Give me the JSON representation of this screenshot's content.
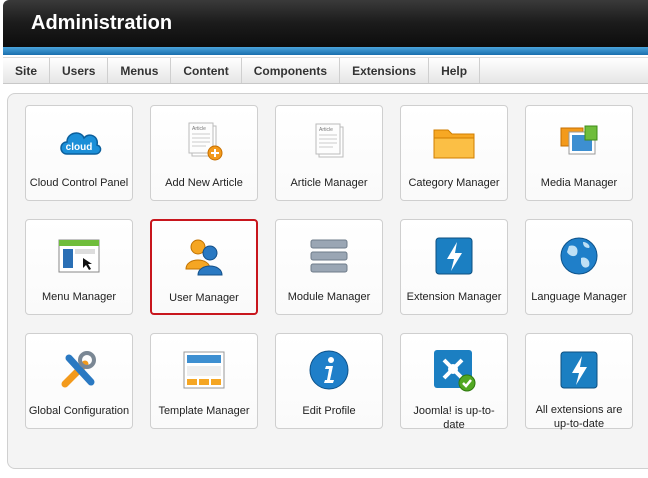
{
  "header": {
    "title": "Administration"
  },
  "menu": [
    "Site",
    "Users",
    "Menus",
    "Content",
    "Components",
    "Extensions",
    "Help"
  ],
  "tiles": [
    {
      "label": "Cloud Control Panel",
      "icon": "cloud-icon"
    },
    {
      "label": "Add New Article",
      "icon": "add-article-icon"
    },
    {
      "label": "Article Manager",
      "icon": "article-icon"
    },
    {
      "label": "Category Manager",
      "icon": "folder-icon"
    },
    {
      "label": "Media Manager",
      "icon": "media-icon"
    },
    {
      "label": "Menu Manager",
      "icon": "menu-icon"
    },
    {
      "label": "User Manager",
      "icon": "users-icon"
    },
    {
      "label": "Module Manager",
      "icon": "module-icon"
    },
    {
      "label": "Extension Manager",
      "icon": "extension-icon"
    },
    {
      "label": "Language Manager",
      "icon": "globe-icon"
    },
    {
      "label": "Global Configuration",
      "icon": "tools-icon"
    },
    {
      "label": "Template Manager",
      "icon": "template-icon"
    },
    {
      "label": "Edit Profile",
      "icon": "info-icon"
    },
    {
      "label": "Joomla! is up-to-date",
      "icon": "joomla-check-icon"
    },
    {
      "label": "All extensions are up-to-date",
      "icon": "extensions-update-icon"
    }
  ],
  "icon_text": {
    "cloud": "cloud",
    "article": "Article"
  },
  "selected_tile": "User Manager",
  "colors": {
    "header_bg": "#111111",
    "accent_blue": "#1a7cc1",
    "selected_border": "#c8161d"
  }
}
